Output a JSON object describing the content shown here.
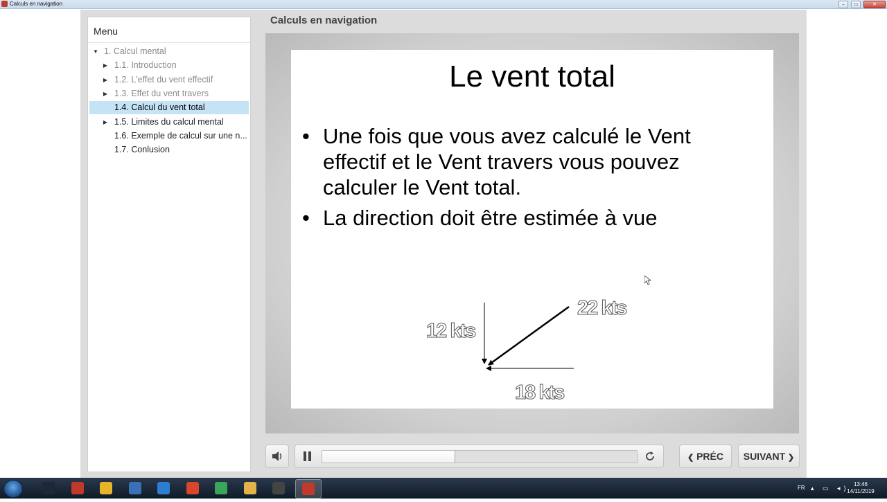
{
  "window": {
    "title": "Calculs en navigation",
    "buttons": [
      "–",
      "▭",
      "✕"
    ]
  },
  "sidebar": {
    "title": "Menu",
    "items": [
      {
        "label": "1. Calcul mental",
        "arrow": "down",
        "state": "dim",
        "indent": 0
      },
      {
        "label": "1.1. Introduction",
        "arrow": "right",
        "state": "dim",
        "indent": 1
      },
      {
        "label": "1.2. L'effet du vent effectif",
        "arrow": "right",
        "state": "dim",
        "indent": 1
      },
      {
        "label": "1.3. Effet du vent travers",
        "arrow": "right",
        "state": "dim",
        "indent": 1
      },
      {
        "label": "1.4. Calcul du vent total",
        "arrow": "none",
        "state": "active",
        "indent": 1
      },
      {
        "label": "1.5. Limites du calcul mental",
        "arrow": "right",
        "state": "dark",
        "indent": 1
      },
      {
        "label": "1.6. Exemple de calcul sur une n...",
        "arrow": "none",
        "state": "dark",
        "indent": 1
      },
      {
        "label": "1.7. Conlusion",
        "arrow": "none",
        "state": "dark",
        "indent": 1
      }
    ]
  },
  "content": {
    "title": "Calculs en navigation",
    "slide": {
      "title": "Le vent total",
      "bullets": [
        "Une fois que vous avez calculé le Vent effectif et le Vent travers vous pouvez calculer le Vent total.",
        "La direction doit être estimée à vue"
      ],
      "diagram": {
        "left_label": "12 kts",
        "right_label": "22 kts",
        "bottom_label": "18 kts"
      }
    }
  },
  "controls": {
    "progress": 0.42,
    "prev_label": "PRÉC",
    "next_label": "SUIVANT"
  },
  "taskbar": {
    "lang": "FR",
    "time": "13:46",
    "date": "14/11/2019",
    "apps": [
      {
        "name": "steam-icon",
        "color": "#1b2838"
      },
      {
        "name": "articulate-icon",
        "color": "#c0392b"
      },
      {
        "name": "chrome-icon",
        "color": "#e8b42a"
      },
      {
        "name": "editor-icon",
        "color": "#3b6fb6"
      },
      {
        "name": "messenger-icon",
        "color": "#2d7dd2"
      },
      {
        "name": "ccleaner-icon",
        "color": "#d9462b"
      },
      {
        "name": "utility-icon",
        "color": "#3aa657"
      },
      {
        "name": "folder-icon",
        "color": "#e3b34a"
      },
      {
        "name": "obs-icon",
        "color": "#444444"
      },
      {
        "name": "articulate-active-icon",
        "color": "#c0392b"
      }
    ]
  },
  "colors": {
    "accent": "#c6e2f5",
    "frame": "#dcdcdc"
  }
}
